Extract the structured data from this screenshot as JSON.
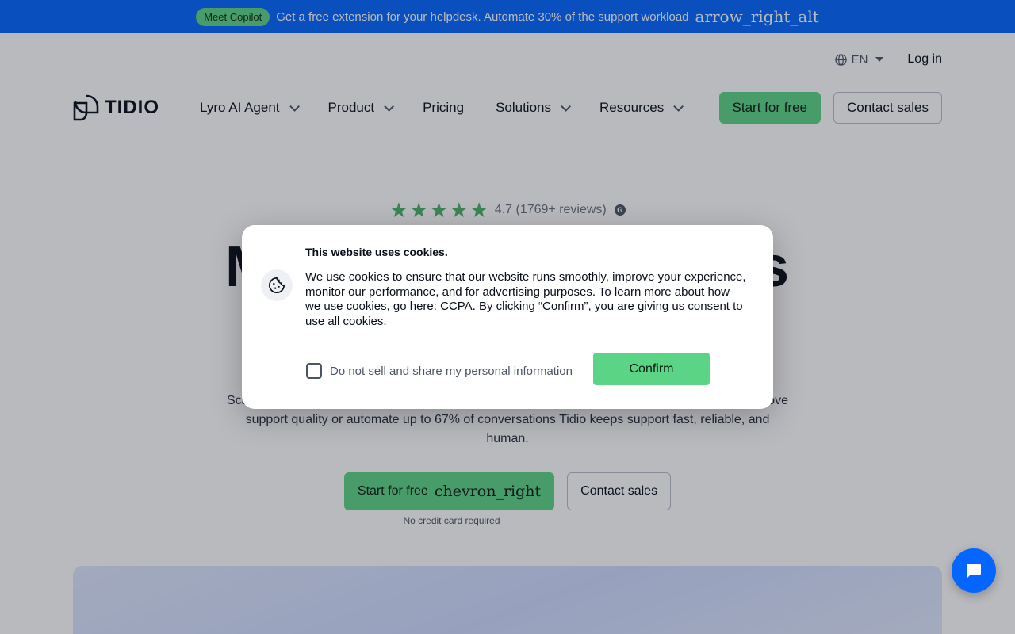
{
  "announcement": {
    "badge": "Meet Copilot",
    "text": "Get a free extension for your helpdesk. Automate 30% of the support workload",
    "arrow_icon_label": "arrow_right_alt"
  },
  "utility": {
    "language": "EN",
    "login": "Log in"
  },
  "nav": {
    "logo_text": "TIDIO",
    "items": [
      {
        "label": "Lyro AI Agent",
        "dropdown": true
      },
      {
        "label": "Product",
        "dropdown": true
      },
      {
        "label": "Pricing",
        "dropdown": false
      },
      {
        "label": "Solutions",
        "dropdown": true
      },
      {
        "label": "Resources",
        "dropdown": true
      }
    ],
    "cta_primary": "Start for free",
    "cta_secondary": "Contact sales"
  },
  "hero": {
    "stars": 5,
    "rating": "4.7 (1769+ reviews)",
    "title_visible_left": "M",
    "title_visible_right": "s",
    "description_line1_left": "Sca",
    "description_line1_right": "ove",
    "description_line2": "support quality or automate up to 67% of conversations Tidio keeps support fast, reliable, and human.",
    "cta_primary": "Start for free",
    "cta_primary_icon_label": "chevron_right",
    "cta_secondary": "Contact sales",
    "note": "No credit card required"
  },
  "cookie_modal": {
    "title": "This website uses cookies.",
    "body_before_link": "We use cookies to ensure that our website runs smoothly, improve your experience, monitor our performance, and for advertising purposes. To learn more about how we use cookies, go here: ",
    "link": "CCPA",
    "body_after_link": ". By clicking “Confirm”, you are giving us consent to use all cookies.",
    "checkbox_label": "Do not sell and share my personal information",
    "checkbox_checked": false,
    "confirm": "Confirm"
  },
  "colors": {
    "brand_blue": "#0566ff",
    "brand_green": "#5cd486",
    "text_dark": "#080f1a"
  }
}
